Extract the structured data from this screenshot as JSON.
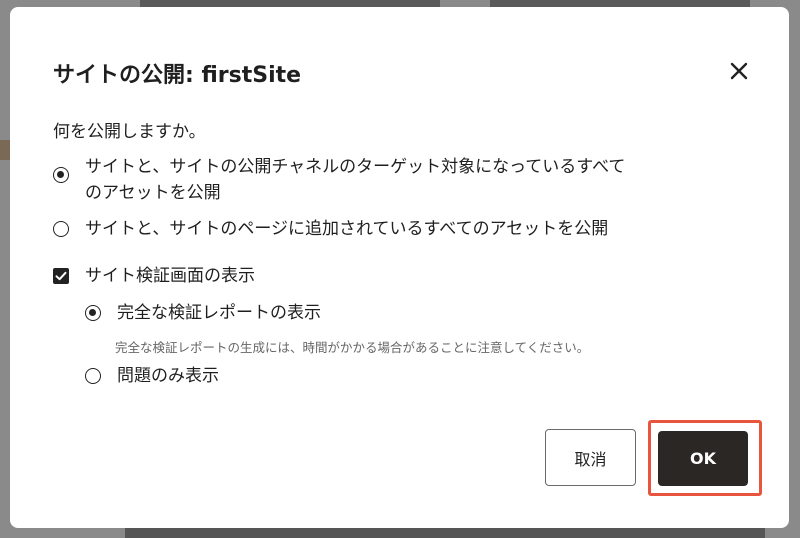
{
  "dialog": {
    "title": "サイトの公開: firstSite",
    "question": "何を公開しますか。",
    "publish_options": [
      {
        "line1": "サイトと、サイトの公開チャネルのターゲット対象になっているすべて",
        "line2": "のアセットを公開",
        "checked": true
      },
      {
        "line1": "サイトと、サイトのページに追加されているすべてのアセットを公開",
        "checked": false
      }
    ],
    "show_validation": {
      "label": "サイト検証画面の表示",
      "checked": true
    },
    "validation_options": [
      {
        "label": "完全な検証レポートの表示",
        "hint": "完全な検証レポートの生成には、時間がかかる場合があることに注意してください。",
        "checked": true
      },
      {
        "label": "問題のみ表示",
        "checked": false
      }
    ],
    "buttons": {
      "cancel": "取消",
      "ok": "OK"
    },
    "colors": {
      "primary_button": "#2b2724",
      "highlight_border": "#e8553f"
    }
  }
}
